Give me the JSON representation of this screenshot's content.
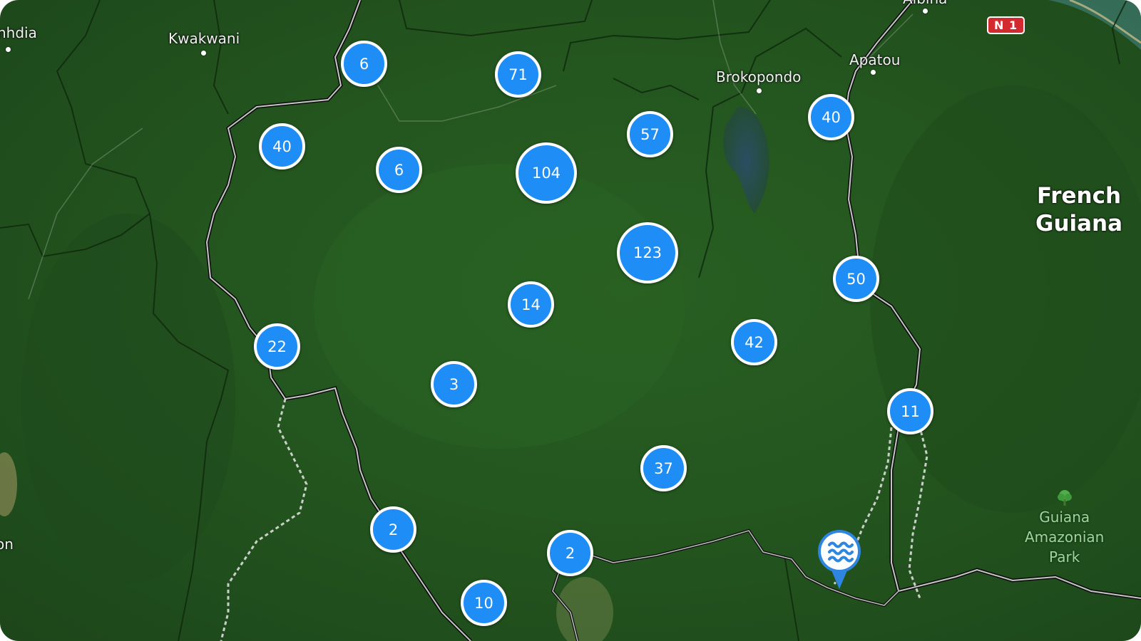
{
  "map": {
    "places": [
      {
        "name": "town-label-nhdia",
        "text": "nhdia"
      },
      {
        "name": "town-label-kwakwani",
        "text": "Kwakwani"
      },
      {
        "name": "town-label-brokopondo",
        "text": "Brokopondo"
      },
      {
        "name": "town-label-apatou",
        "text": "Apatou"
      },
      {
        "name": "town-label-albina",
        "text": "Albina"
      },
      {
        "name": "town-label-partial-left",
        "text": "on"
      }
    ],
    "region": {
      "line1": "French",
      "line2": "Guiana"
    },
    "park": {
      "line1": "Guiana",
      "line2": "Amazonian",
      "line3": "Park"
    },
    "road_shield": "N 1",
    "clusters": [
      "6",
      "71",
      "40",
      "6",
      "104",
      "57",
      "40",
      "123",
      "50",
      "14",
      "42",
      "22",
      "3",
      "11",
      "37",
      "2",
      "2",
      "10"
    ],
    "marker_icon": "water-waves-icon",
    "park_icon": "tree-icon",
    "colors": {
      "cluster": "#1e8df5",
      "cluster_border": "#ffffff",
      "forest": "#24561f",
      "border_line": "#111111"
    }
  }
}
